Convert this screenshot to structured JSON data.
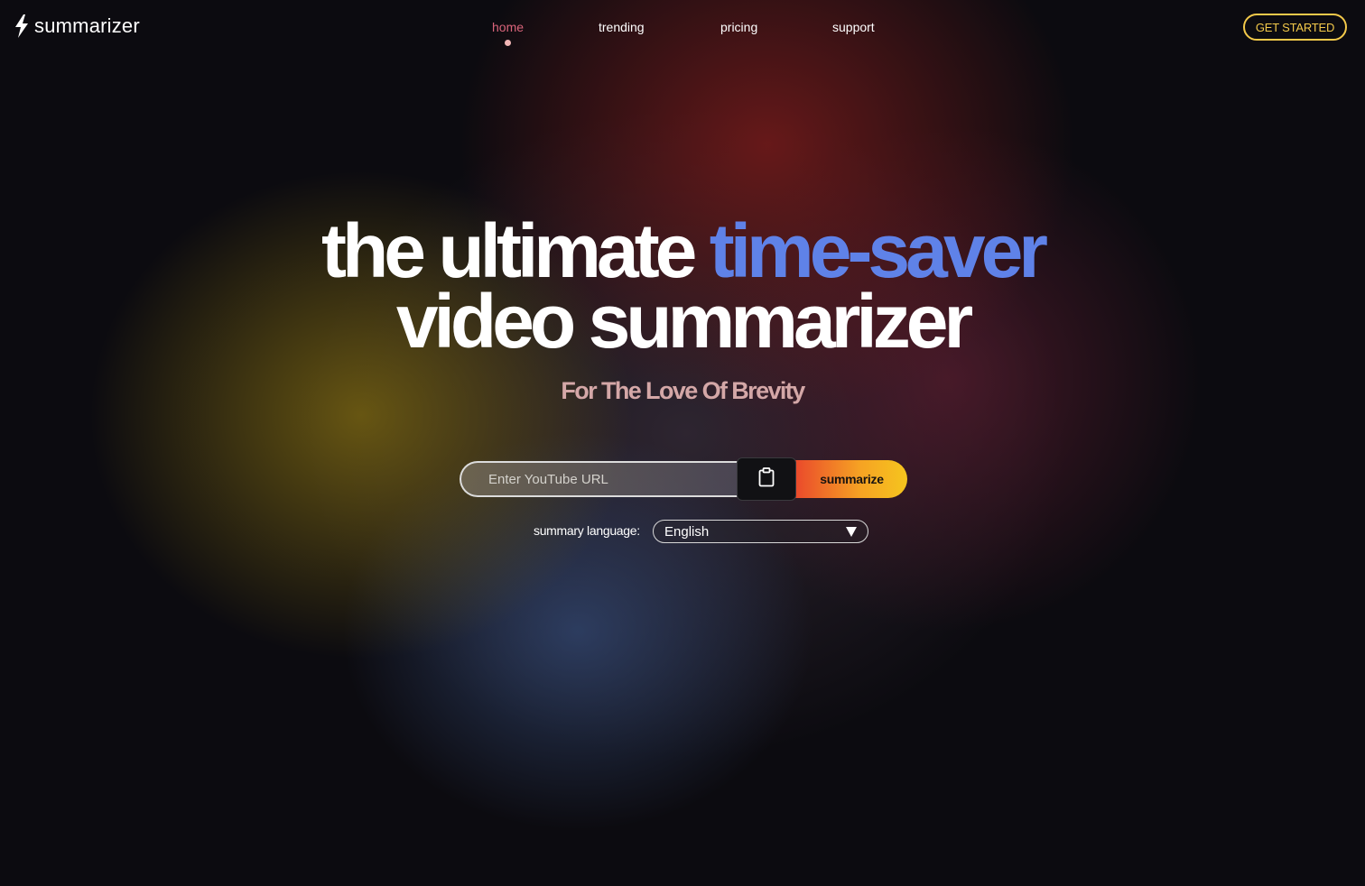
{
  "brand": {
    "name": "summarizer",
    "logo_icon": "lightning-bolt-icon"
  },
  "nav": {
    "items": [
      {
        "label": "home",
        "active": true
      },
      {
        "label": "trending",
        "active": false
      },
      {
        "label": "pricing",
        "active": false
      },
      {
        "label": "support",
        "active": false
      }
    ],
    "cta_label": "GET STARTED"
  },
  "hero": {
    "line1_plain": "the ultimate ",
    "line1_accent": "time-saver",
    "line2": "video summarizer",
    "tagline": "For The Love Of Brevity"
  },
  "form": {
    "url_placeholder": "Enter YouTube URL",
    "url_value": "",
    "paste_icon": "clipboard-icon",
    "submit_label": "summarize",
    "language_label": "summary language:",
    "language_selected": "English"
  },
  "colors": {
    "accent_blue": "#5f82e8",
    "active_nav": "#d9647a",
    "cta_yellow": "#f3c94a",
    "tagline": "#d4a7a7",
    "button_gradient_start": "#e9432c",
    "button_gradient_end": "#f5c51e"
  }
}
